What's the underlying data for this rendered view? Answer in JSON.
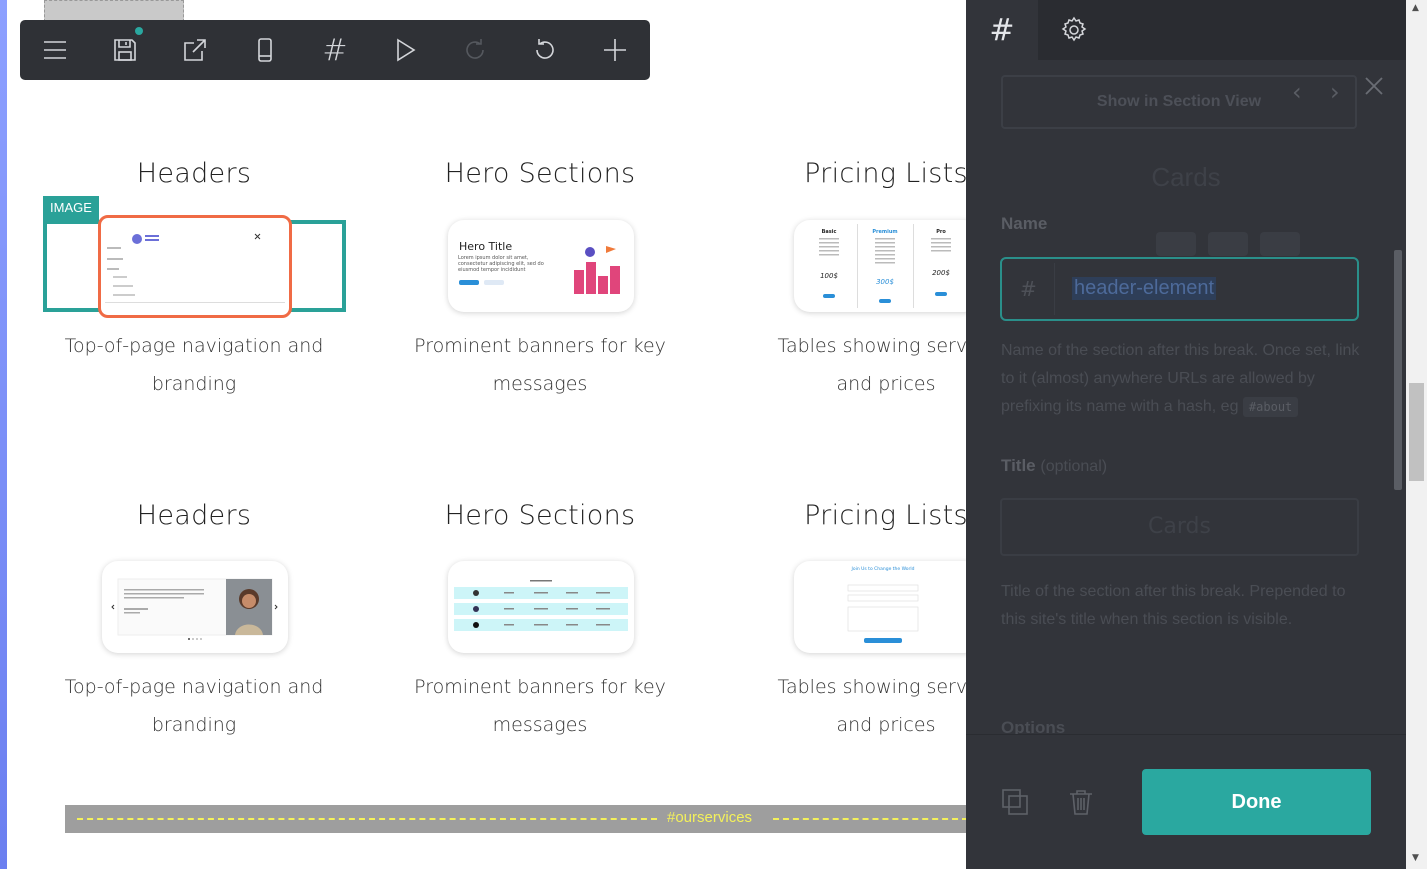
{
  "toolbar": {
    "dot_color": "#2aa8a0",
    "icons": [
      "menu-icon",
      "save-icon",
      "open-external-icon",
      "mobile-view-icon",
      "hash-icon",
      "play-icon",
      "redo-icon",
      "undo-icon",
      "add-icon"
    ],
    "hash_glyph": "#"
  },
  "cards": [
    {
      "title": "Headers",
      "desc1": "Top-of-page navigation and",
      "desc2": "branding"
    },
    {
      "title": "Hero Sections",
      "desc1": "Prominent banners for key",
      "desc2": "messages"
    },
    {
      "title": "Pricing Lists",
      "desc1": "Tables showing service",
      "desc2": "and prices"
    },
    {
      "title": "Headers",
      "desc1": "Top-of-page navigation and",
      "desc2": "branding"
    },
    {
      "title": "Hero Sections",
      "desc1": "Prominent banners for key",
      "desc2": "messages"
    },
    {
      "title": "Pricing Lists",
      "desc1": "Tables showing service",
      "desc2": "and prices"
    }
  ],
  "image_badge": "IMAGE",
  "hero_thumb": {
    "title": "Hero Title",
    "text": "Lorem ipsum dolor sit amet, consectetur adipiscing elit, sed do eiusmod tempor incididunt"
  },
  "pricing_thumb": {
    "plans": [
      "Basic",
      "Premium",
      "Pro"
    ],
    "prices": [
      "100$",
      "300$",
      "200$"
    ]
  },
  "form_thumb": {
    "title": "Join Us to Change the World"
  },
  "section_break": {
    "label": "#ourservices"
  },
  "panel": {
    "tab_hash": "#",
    "section_view_button": "Show in Section View",
    "prev_arrow": "‹",
    "next_arrow": "›",
    "ghost_heading": "Cards",
    "name_label": "Name",
    "name_hash": "#",
    "name_value": "header-element",
    "name_help": "Name of the section after this break. Once set, link to it (almost) anywhere URLs are allowed by prefixing its name with a hash, eg",
    "name_help_code": "#about",
    "title_label": "Title",
    "title_optional": "(optional)",
    "title_value": "Cards",
    "title_help": "Title of the section after this break. Prepended to this site's title when this section is visible.",
    "options_label": "Options",
    "done_button": "Done"
  }
}
